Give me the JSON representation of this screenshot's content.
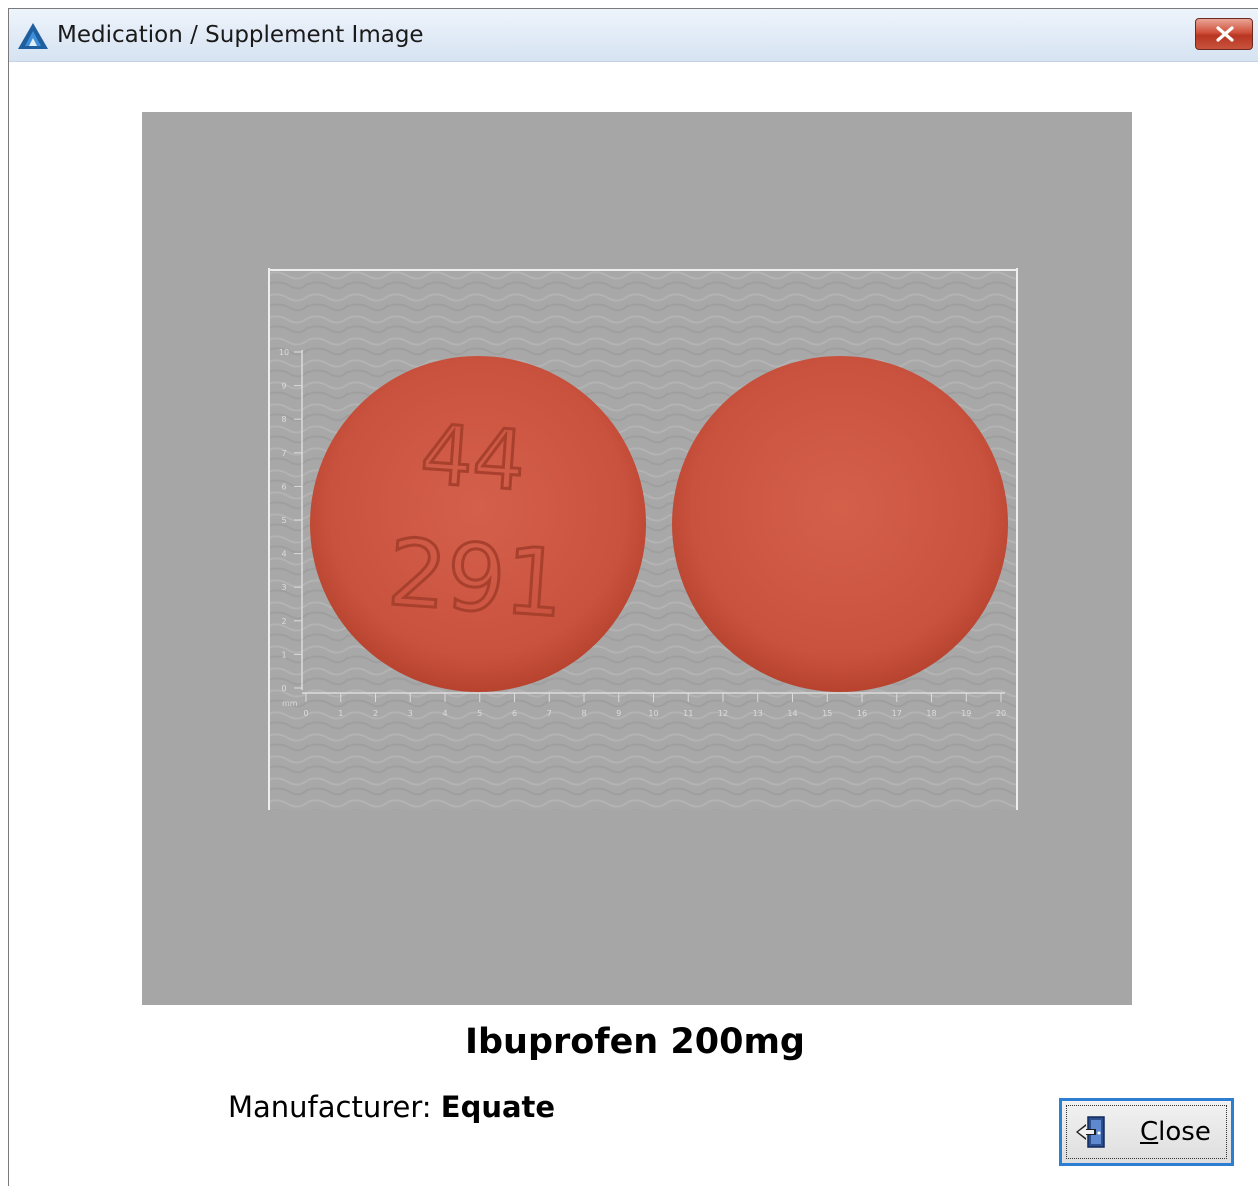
{
  "window": {
    "title": "Medication / Supplement Image",
    "app_icon": "triangle-logo-icon",
    "close_icon": "close-x-icon"
  },
  "image": {
    "pill_imprint_line1": "44",
    "pill_imprint_line2": "291",
    "pill_color": "#c9523e",
    "background_color": "#a6a6a6",
    "ruler_unit": "mm",
    "x_ticks": [
      "0",
      "1",
      "2",
      "3",
      "4",
      "5",
      "6",
      "7",
      "8",
      "9",
      "10",
      "11",
      "12",
      "13",
      "14",
      "15",
      "16",
      "17",
      "18",
      "19",
      "20"
    ],
    "y_ticks": [
      "0",
      "1",
      "2",
      "3",
      "4",
      "5",
      "6",
      "7",
      "8",
      "9",
      "10"
    ]
  },
  "medication": {
    "name": "Ibuprofen 200mg",
    "manufacturer_label": "Manufacturer:",
    "manufacturer_value": "Equate"
  },
  "buttons": {
    "close_label_accel": "C",
    "close_label_rest": "lose",
    "close_icon": "exit-door-icon"
  }
}
